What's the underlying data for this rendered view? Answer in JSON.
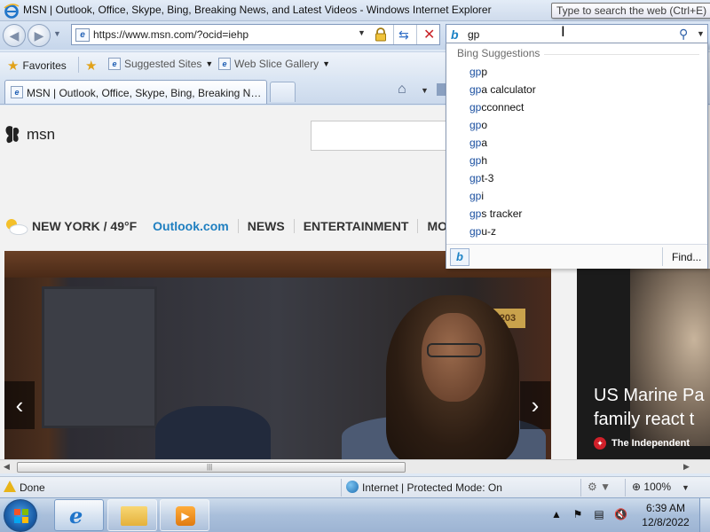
{
  "window": {
    "title": "MSN | Outlook, Office, Skype, Bing, Breaking News, and Latest Videos - Windows Internet Explorer",
    "search_tooltip": "Type to search the web (Ctrl+E)"
  },
  "navbar": {
    "address": "https://www.msn.com/?ocid=iehp",
    "search_query": "gp"
  },
  "favorites_bar": {
    "favorites_label": "Favorites",
    "suggested_sites_label": "Suggested Sites",
    "web_slice_label": "Web Slice Gallery"
  },
  "tabs": {
    "active_title": "MSN | Outlook, Office, Skype, Bing, Breaking News, and Latest Videos"
  },
  "suggestions": {
    "header": "Bing Suggestions",
    "typed": "gp",
    "items": [
      {
        "suffix": "p"
      },
      {
        "suffix": "a calculator"
      },
      {
        "suffix": "cconnect"
      },
      {
        "suffix": "o"
      },
      {
        "suffix": "a"
      },
      {
        "suffix": "h"
      },
      {
        "suffix": "t-3"
      },
      {
        "suffix": "i"
      },
      {
        "suffix": "s tracker"
      },
      {
        "suffix": "u-z"
      }
    ],
    "find_label": "Find..."
  },
  "page": {
    "logo_text": "msn",
    "weather": "NEW YORK / 49°F",
    "nav_links": [
      "Outlook.com",
      "NEWS",
      "ENTERTAINMENT",
      "MONEY"
    ],
    "hero_sign": "203",
    "side_headline_line1": "US Marine Pa",
    "side_headline_line2": "family react t",
    "side_source": "The Independent"
  },
  "statusbar": {
    "status": "Done",
    "zone": "Internet | Protected Mode: On",
    "zoom": "100%"
  },
  "taskbar": {
    "time": "6:39 AM",
    "date": "12/8/2022"
  },
  "colors": {
    "link_blue": "#1f7fc0",
    "bing_blue": "#1d83c6",
    "suggest_match": "#1a4fa0"
  }
}
